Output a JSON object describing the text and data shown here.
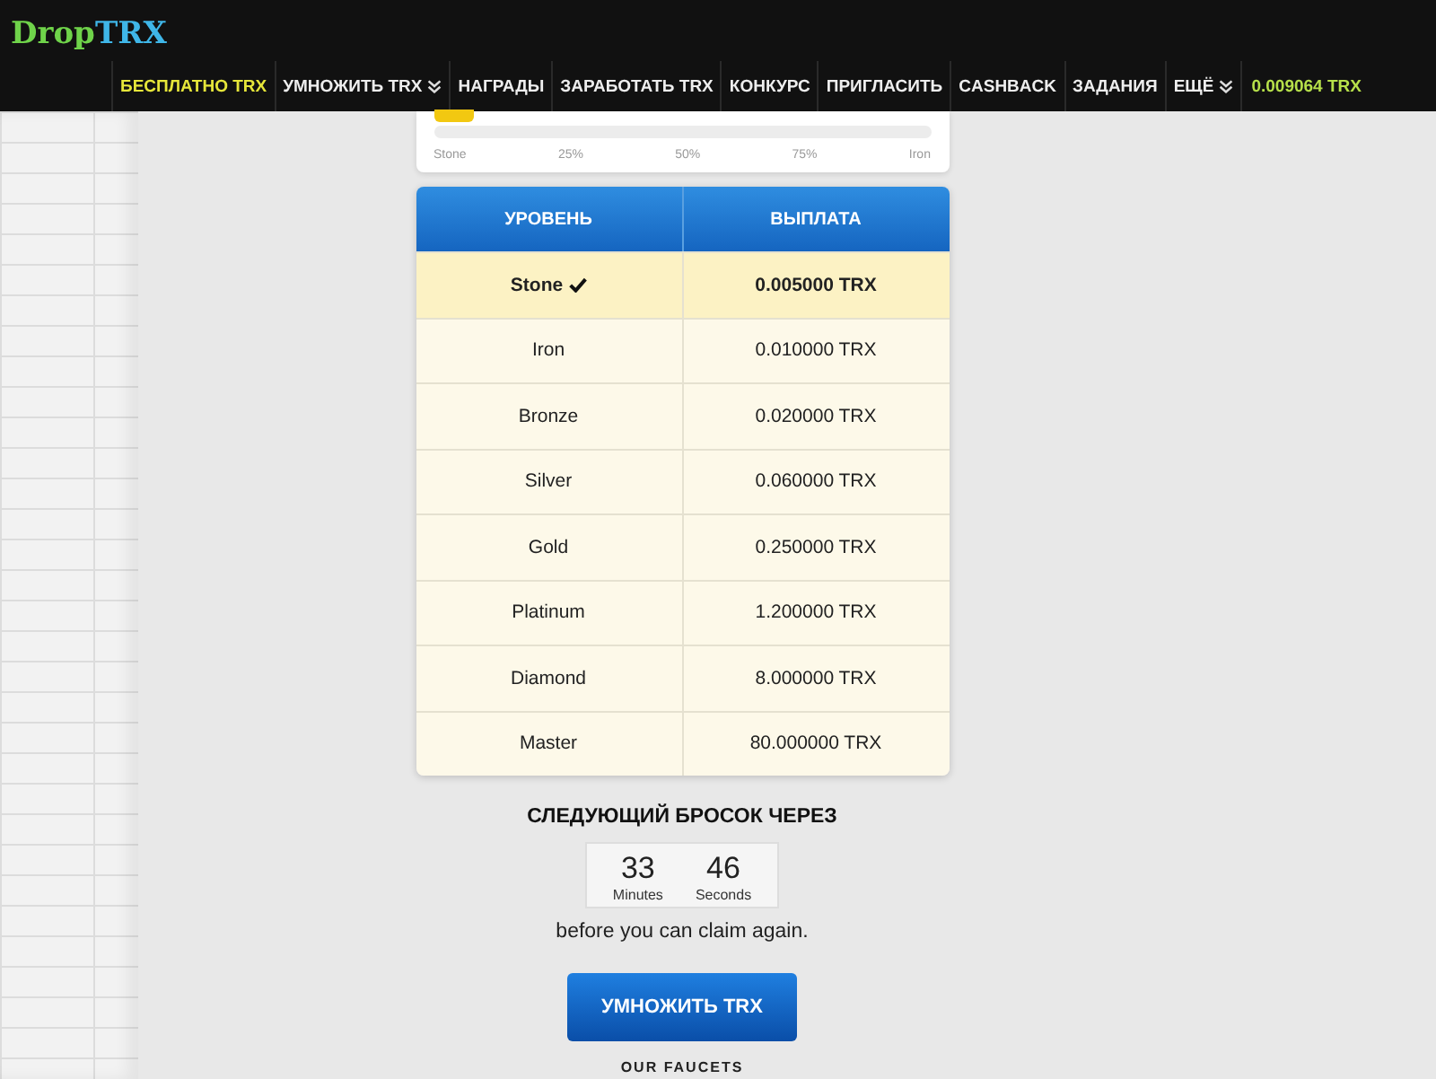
{
  "header": {
    "logo": {
      "part_1": "Drop",
      "part_2": "TRX"
    },
    "nav": [
      {
        "label": "БЕСПЛАТНО TRX",
        "selected": true,
        "dropdown": false
      },
      {
        "label": "УМНОЖИТЬ TRX",
        "selected": false,
        "dropdown": true
      },
      {
        "label": "НАГРАДЫ",
        "selected": false,
        "dropdown": false
      },
      {
        "label": "ЗАРАБОТАТЬ TRX",
        "selected": false,
        "dropdown": false
      },
      {
        "label": "КОНКУРС",
        "selected": false,
        "dropdown": false
      },
      {
        "label": "ПРИГЛАСИТЬ",
        "selected": false,
        "dropdown": false
      },
      {
        "label": "CASHBACK",
        "selected": false,
        "dropdown": false
      },
      {
        "label": "ЗАДАНИЯ",
        "selected": false,
        "dropdown": false
      },
      {
        "label": "ЕЩЁ",
        "selected": false,
        "dropdown": true
      }
    ],
    "balance": "0.009064 TRX"
  },
  "progress": {
    "level": 0,
    "labels": [
      "Stone",
      "25%",
      "50%",
      "75%",
      "Iron"
    ]
  },
  "levels_table": {
    "columns": [
      "УРОВЕНЬ",
      "ВЫПЛАТА"
    ],
    "rows": [
      {
        "level": "Stone",
        "payout": "0.005000 TRX",
        "selected": true
      },
      {
        "level": "Iron",
        "payout": "0.010000 TRX",
        "selected": false
      },
      {
        "level": "Bronze",
        "payout": "0.020000 TRX",
        "selected": false
      },
      {
        "level": "Silver",
        "payout": "0.060000 TRX",
        "selected": false
      },
      {
        "level": "Gold",
        "payout": "0.250000 TRX",
        "selected": false
      },
      {
        "level": "Platinum",
        "payout": "1.200000 TRX",
        "selected": false
      },
      {
        "level": "Diamond",
        "payout": "8.000000 TRX",
        "selected": false
      },
      {
        "level": "Master",
        "payout": "80.000000 TRX",
        "selected": false
      }
    ]
  },
  "countdown": {
    "heading": "СЛЕДУЮЩИЙ БРОСОК ЧЕРЕЗ",
    "units": [
      {
        "value": "33",
        "label": "Minutes"
      },
      {
        "value": "46",
        "label": "Seconds"
      }
    ],
    "note": "before you can claim again."
  },
  "multiply_button": "УМНОЖИТЬ TRX",
  "section_heading": "OUR FAUCETS"
}
